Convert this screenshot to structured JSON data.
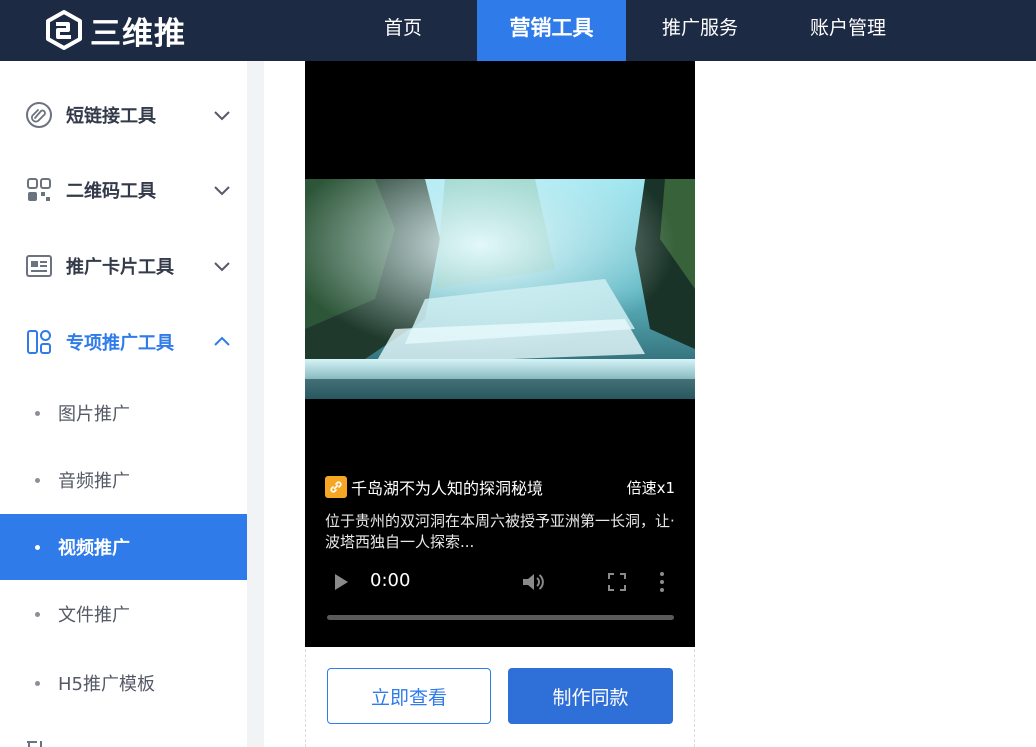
{
  "header": {
    "logo_text": "三维推",
    "nav": [
      {
        "label": "首页",
        "active": false
      },
      {
        "label": "营销工具",
        "active": true
      },
      {
        "label": "推广服务",
        "active": false
      },
      {
        "label": "账户管理",
        "active": false
      }
    ]
  },
  "sidebar": {
    "groups": [
      {
        "label": "短链接工具",
        "icon": "paperclip-icon",
        "expanded": false
      },
      {
        "label": "二维码工具",
        "icon": "qrcode-icon",
        "expanded": false
      },
      {
        "label": "推广卡片工具",
        "icon": "card-icon",
        "expanded": false
      },
      {
        "label": "专项推广工具",
        "icon": "widgets-icon",
        "expanded": true
      }
    ],
    "sub_items": [
      {
        "label": "图片推广",
        "active": false
      },
      {
        "label": "音频推广",
        "active": false
      },
      {
        "label": "视频推广",
        "active": true
      },
      {
        "label": "文件推广",
        "active": false
      },
      {
        "label": "H5推广模板",
        "active": false
      }
    ]
  },
  "video_card": {
    "title": "千岛湖不为人知的探洞秘境",
    "speed": "倍速x1",
    "description": "位于贵州的双河洞在本周六被授予亚洲第一长洞，让·波塔西独自一人探索...",
    "time": "0:00",
    "progress": 0
  },
  "actions": {
    "view_label": "立即查看",
    "make_label": "制作同款"
  },
  "colors": {
    "topbar": "#1d2a44",
    "accent": "#2f7bea",
    "badge": "#f5a623"
  }
}
